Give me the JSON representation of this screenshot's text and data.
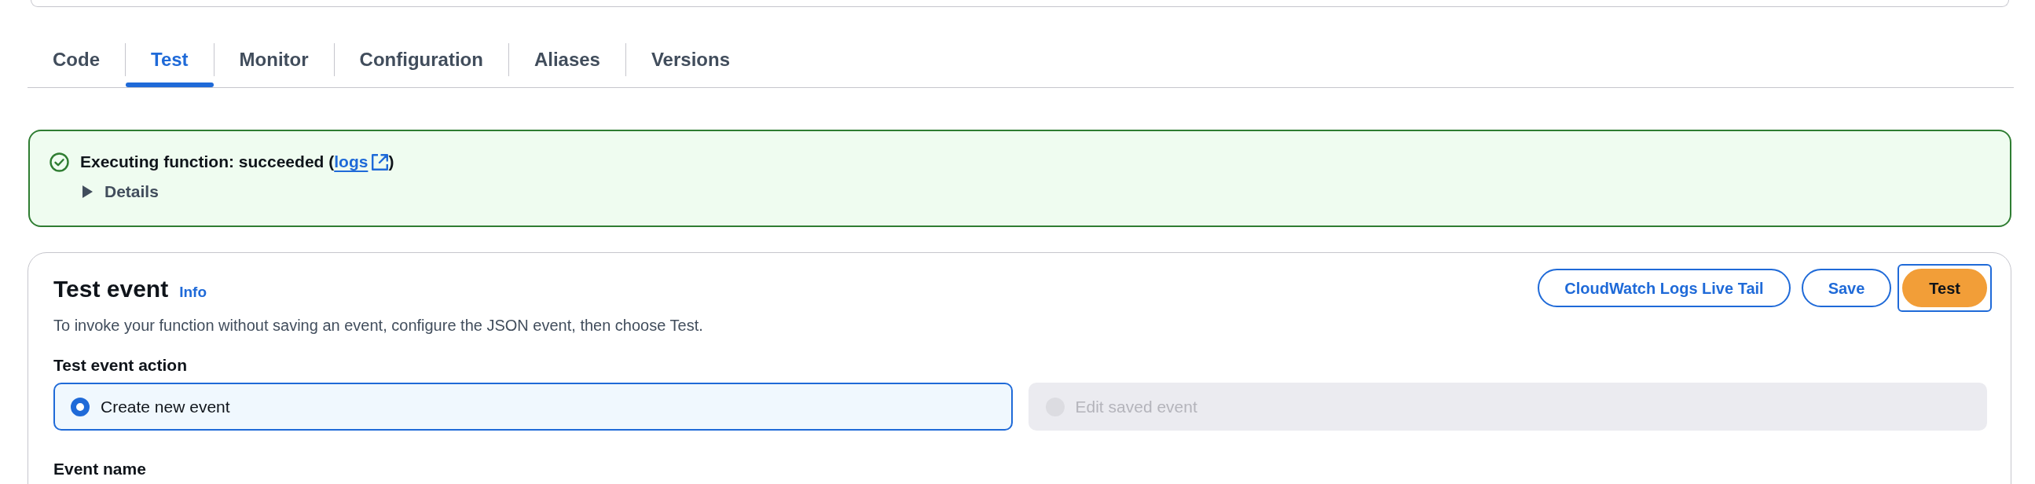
{
  "tabs": [
    {
      "label": "Code",
      "selected": false
    },
    {
      "label": "Test",
      "selected": true
    },
    {
      "label": "Monitor",
      "selected": false
    },
    {
      "label": "Configuration",
      "selected": false
    },
    {
      "label": "Aliases",
      "selected": false
    },
    {
      "label": "Versions",
      "selected": false
    }
  ],
  "alert": {
    "kind": "success",
    "message_before": "Executing function: succeeded (",
    "link": "logs",
    "message_after": ")",
    "details": {
      "label": "Details",
      "expanded": false
    }
  },
  "test_event": {
    "title": "Test event",
    "info": "Info",
    "description": "To invoke your function without saving an event, configure the JSON event, then choose Test.",
    "buttons": [
      {
        "label": "CloudWatch Logs Live Tail",
        "kind": "normal",
        "focused": false
      },
      {
        "label": "Save",
        "kind": "normal",
        "focused": false
      },
      {
        "label": "Test",
        "kind": "primary",
        "focused": true
      }
    ],
    "action": {
      "label": "Test event action",
      "options": [
        {
          "label": "Create new event",
          "selected": true,
          "disabled": false
        },
        {
          "label": "Edit saved event",
          "selected": false,
          "disabled": true
        }
      ]
    },
    "event_name": {
      "label": "Event name"
    }
  }
}
